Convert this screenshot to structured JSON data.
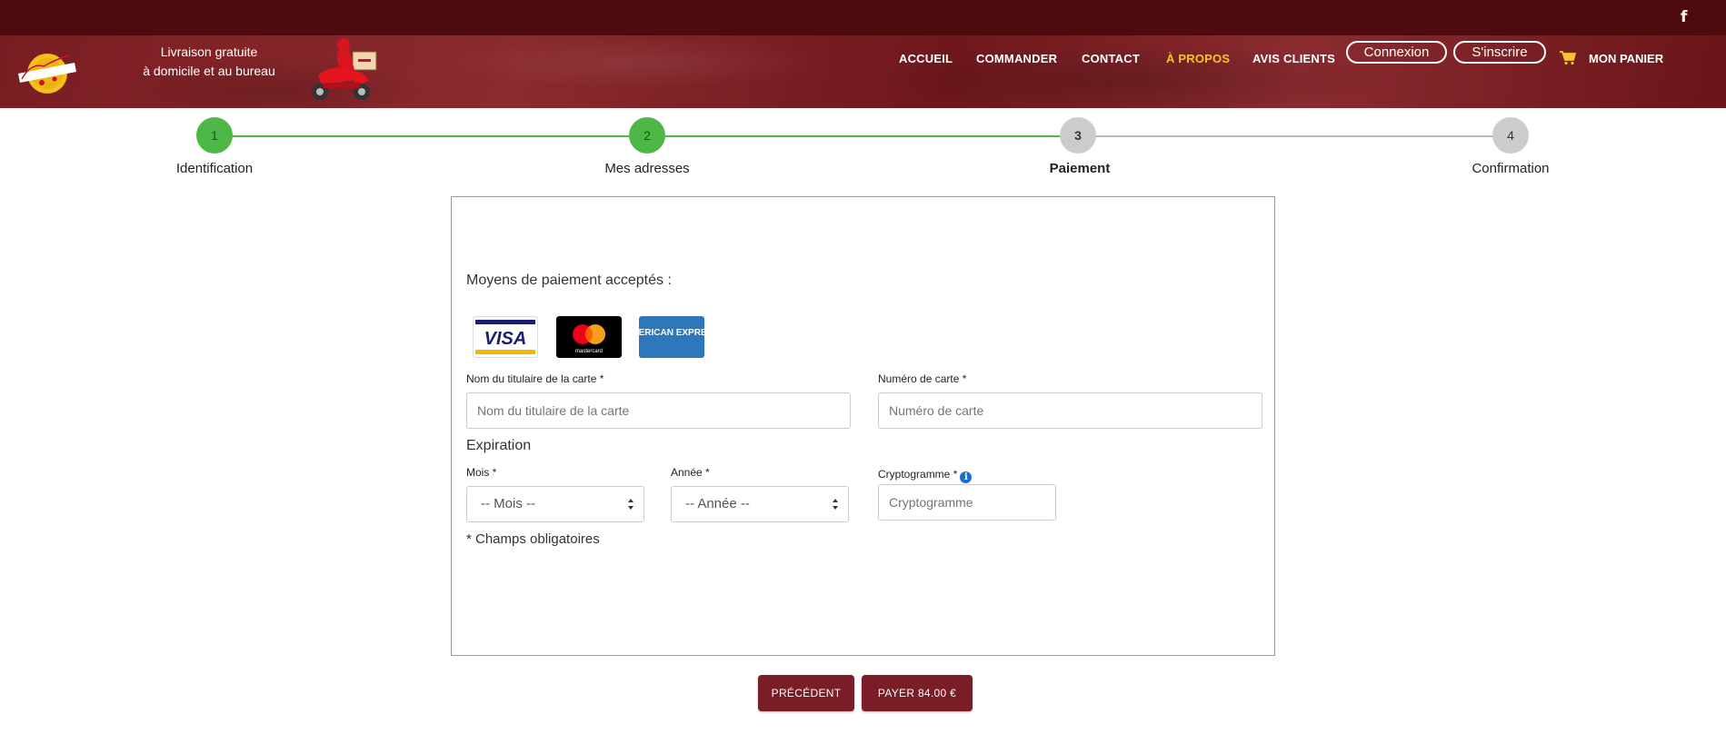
{
  "header": {
    "tagline_line1": "Livraison gratuite",
    "tagline_line2": "à domicile et au bureau",
    "logo_icon": "marlu-pizza-logo",
    "nav": [
      {
        "label": "ACCUEIL",
        "active": false
      },
      {
        "label": "COMMANDER",
        "active": false
      },
      {
        "label": "CONTACT",
        "active": false
      },
      {
        "label": "À PROPOS",
        "active": true
      },
      {
        "label": "AVIS CLIENTS",
        "active": false
      }
    ],
    "login_label": "Connexion",
    "signup_label": "S'inscrire",
    "cart_label": "MON PANIER",
    "active_color": "#f4c430",
    "brand_color": "#4e0a0d"
  },
  "steps": [
    {
      "number": "1",
      "label": "Identification",
      "state": "done"
    },
    {
      "number": "2",
      "label": "Mes adresses",
      "state": "done"
    },
    {
      "number": "3",
      "label": "Paiement",
      "state": "current"
    },
    {
      "number": "4",
      "label": "Confirmation",
      "state": "todo"
    }
  ],
  "payment": {
    "accepted_title": "Moyens de paiement acceptés :",
    "card_brands": [
      "VISA",
      "mastercard",
      "AMERICAN EXPRESS"
    ],
    "holder_label": "Nom du titulaire de la carte *",
    "holder_placeholder": "Nom du titulaire de la carte",
    "number_label": "Numéro de carte *",
    "number_placeholder": "Numéro de carte",
    "expiration_title": "Expiration",
    "month_label": "Mois *",
    "month_value": "-- Mois --",
    "year_label": "Année *",
    "year_value": "-- Année --",
    "cvv_label": "Cryptogramme *",
    "cvv_placeholder": "Cryptogramme",
    "required_note": "* Champs obligatoires"
  },
  "actions": {
    "previous_label": "PRÉCÉDENT",
    "pay_label": "PAYER 84.00 €"
  }
}
